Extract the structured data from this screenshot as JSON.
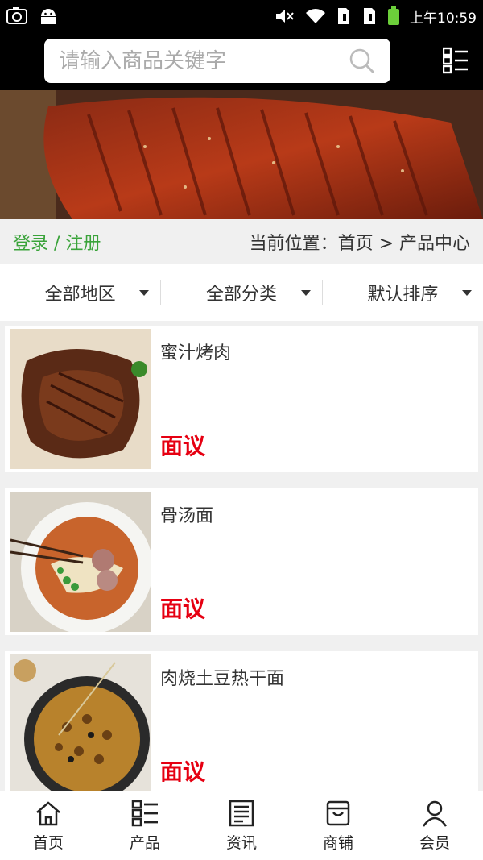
{
  "status": {
    "time": "上午10:59"
  },
  "search": {
    "placeholder": "请输入商品关键字"
  },
  "breadcrumb": {
    "login": "登录 / 注册",
    "location": "当前位置：首页 > 产品中心"
  },
  "filters": [
    {
      "label": "全部地区"
    },
    {
      "label": "全部分类"
    },
    {
      "label": "默认排序"
    }
  ],
  "products": [
    {
      "name": "蜜汁烤肉",
      "price": "面议"
    },
    {
      "name": "骨汤面",
      "price": "面议"
    },
    {
      "name": "肉烧土豆热干面",
      "price": "面议"
    }
  ],
  "tabs": [
    {
      "label": "首页",
      "icon": "home-icon"
    },
    {
      "label": "产品",
      "icon": "grid-list-icon"
    },
    {
      "label": "资讯",
      "icon": "news-icon"
    },
    {
      "label": "商铺",
      "icon": "shop-icon"
    },
    {
      "label": "会员",
      "icon": "user-icon"
    }
  ],
  "colors": {
    "accent_green": "#3aa33a",
    "price_red": "#e60012",
    "header_bg": "#000000"
  }
}
